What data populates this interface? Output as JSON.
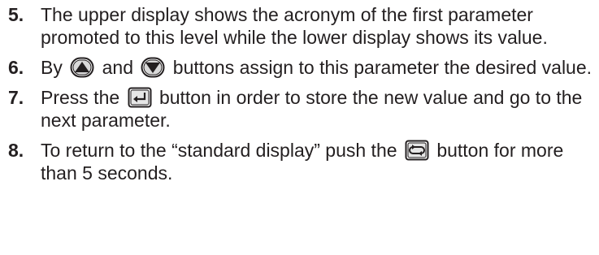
{
  "steps": [
    {
      "number": "5.",
      "text": "The upper display shows the acronym of the first parameter promoted to this level while the lower display shows its value."
    },
    {
      "number": "6.",
      "before": "By",
      "middle": "and",
      "after": "buttons assign to this parameter the desired value.",
      "icons": [
        "up-arrow-button-icon",
        "down-arrow-button-icon"
      ]
    },
    {
      "number": "7.",
      "before": "Press the",
      "after": "button in order to store the new value and go to the next parameter.",
      "icons": [
        "enter-button-icon"
      ]
    },
    {
      "number": "8.",
      "before": "To return to the “standard display” push the",
      "after": "button for more than 5 seconds.",
      "icons": [
        "cycle-button-icon"
      ]
    }
  ]
}
